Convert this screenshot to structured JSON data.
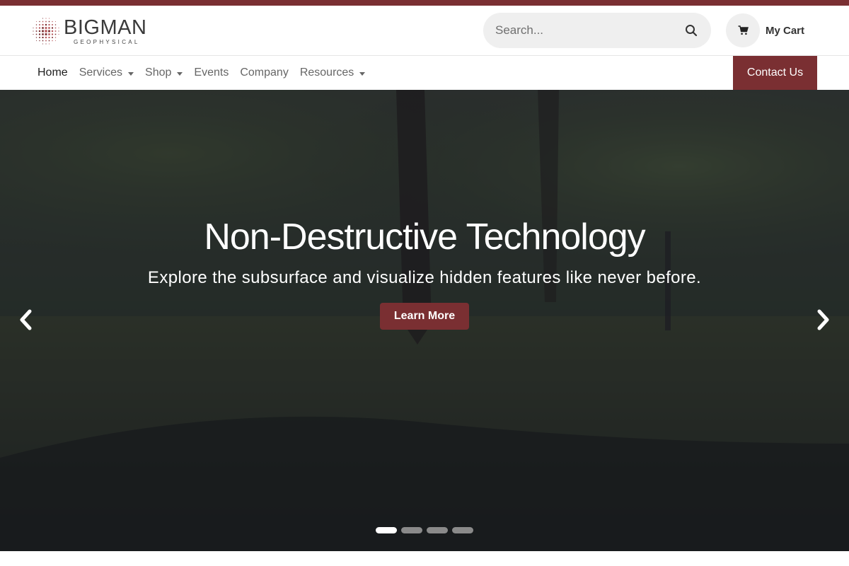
{
  "colors": {
    "brand": "#7a2f32",
    "search_bg": "#efefef",
    "hero_overlay": "rgba(20,22,35,0.55)"
  },
  "logo": {
    "name": "BIGMAN",
    "subtitle": "GEOPHYSICAL",
    "icon": "dotted-globe-logo"
  },
  "search": {
    "placeholder": "Search...",
    "icon": "search-icon"
  },
  "cart": {
    "label": "My Cart",
    "icon": "shopping-cart-icon"
  },
  "nav": {
    "items": [
      {
        "label": "Home",
        "active": true,
        "dropdown": false
      },
      {
        "label": "Services",
        "active": false,
        "dropdown": true
      },
      {
        "label": "Shop",
        "active": false,
        "dropdown": true
      },
      {
        "label": "Events",
        "active": false,
        "dropdown": false
      },
      {
        "label": "Company",
        "active": false,
        "dropdown": false
      },
      {
        "label": "Resources",
        "active": false,
        "dropdown": true
      }
    ],
    "contact_label": "Contact Us"
  },
  "hero": {
    "title": "Non-Destructive Technology",
    "subtitle": "Explore the subsurface and visualize hidden features like never before.",
    "button_label": "Learn More",
    "prev_icon": "chevron-left-icon",
    "next_icon": "chevron-right-icon",
    "slide_count": 4,
    "active_slide": 1
  }
}
